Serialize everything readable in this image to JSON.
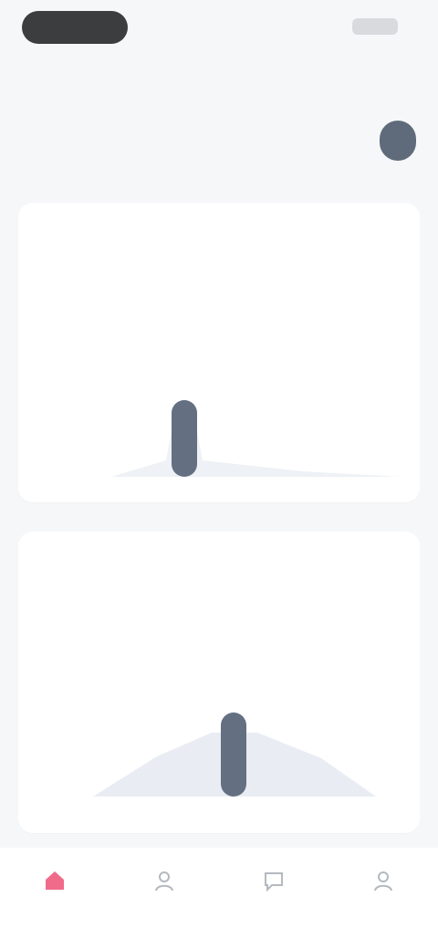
{
  "header": {
    "title": ""
  },
  "segments": [
    {
      "label": ""
    },
    {
      "label": ""
    },
    {
      "label": ""
    },
    {
      "label": ""
    }
  ],
  "cards": [
    {
      "label": "",
      "value": "",
      "subtitle": "",
      "chart_data": {
        "type": "bar",
        "categories": [],
        "values": [],
        "title": "",
        "xlabel": "",
        "ylabel": ""
      }
    },
    {
      "label": "",
      "value": "",
      "subtitle": "",
      "chart_data": {
        "type": "area",
        "categories": [],
        "values": [],
        "title": "",
        "xlabel": "",
        "ylabel": ""
      }
    }
  ],
  "tabbar": {
    "items": [
      {
        "label": "",
        "icon": "home-icon",
        "active": true
      },
      {
        "label": "",
        "icon": "person-icon",
        "active": false
      },
      {
        "label": "",
        "icon": "chat-icon",
        "active": false
      },
      {
        "label": "",
        "icon": "profile-icon",
        "active": false
      }
    ]
  },
  "colors": {
    "accent": "#5f6b7a",
    "active_tab": "#f06b8a",
    "background": "#f6f7f9",
    "card": "#ffffff"
  }
}
